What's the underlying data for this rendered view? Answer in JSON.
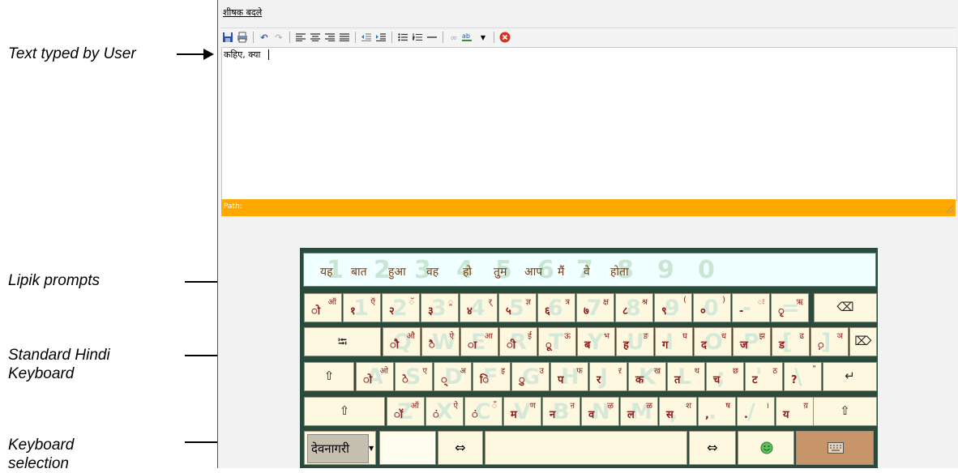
{
  "annotations": {
    "text_typed": "Text typed by User",
    "lipik_prompts": "Lipik prompts",
    "standard_keyboard_line1": "Standard Hindi",
    "standard_keyboard_line2": "Keyboard",
    "keyboard_selection_line1": "Keyboard",
    "keyboard_selection_line2": "selection"
  },
  "editor": {
    "title_link": "शीषक बदले",
    "content": "कहिए, क्या",
    "status_label": "Path:"
  },
  "keyboard": {
    "prompts": [
      "यह",
      "बात",
      "हुआ",
      "वह",
      "हो",
      "तुम",
      "आप",
      "मैं",
      "वे",
      "होता"
    ],
    "prompt_ghost_digits": [
      "1",
      "2",
      "3",
      "4",
      "5",
      "6",
      "7",
      "8",
      "9",
      "0"
    ],
    "rows": [
      [
        {
          "ghost": "",
          "main": "ो",
          "shift": "ऑ"
        },
        {
          "ghost": "1",
          "main": "१",
          "shift": "ऍ"
        },
        {
          "ghost": "2",
          "main": "२",
          "shift": "ॅ"
        },
        {
          "ghost": "3",
          "main": "३",
          "shift": "्र"
        },
        {
          "ghost": "4",
          "main": "४",
          "shift": "र्"
        },
        {
          "ghost": "5",
          "main": "५",
          "shift": "ज्ञ"
        },
        {
          "ghost": "6",
          "main": "६",
          "shift": "त्र"
        },
        {
          "ghost": "7",
          "main": "७",
          "shift": "क्ष"
        },
        {
          "ghost": "8",
          "main": "८",
          "shift": "श्र"
        },
        {
          "ghost": "9",
          "main": "९",
          "shift": "("
        },
        {
          "ghost": "0",
          "main": "०",
          "shift": ")"
        },
        {
          "ghost": "-",
          "main": "-",
          "shift": "ः"
        },
        {
          "ghost": "=",
          "main": "ृ",
          "shift": "ऋ"
        }
      ],
      [
        {
          "ghost": "Q",
          "main": "ौ",
          "shift": "औ"
        },
        {
          "ghost": "W",
          "main": "ै",
          "shift": "ऐ"
        },
        {
          "ghost": "E",
          "main": "ा",
          "shift": "आ"
        },
        {
          "ghost": "R",
          "main": "ी",
          "shift": "ई"
        },
        {
          "ghost": "T",
          "main": "ू",
          "shift": "ऊ"
        },
        {
          "ghost": "Y",
          "main": "ब",
          "shift": "भ"
        },
        {
          "ghost": "U",
          "main": "ह",
          "shift": "ङ"
        },
        {
          "ghost": "I",
          "main": "ग",
          "shift": "घ"
        },
        {
          "ghost": "O",
          "main": "द",
          "shift": "ध"
        },
        {
          "ghost": "P",
          "main": "ज",
          "shift": "झ"
        },
        {
          "ghost": "[",
          "main": "ड",
          "shift": "ढ"
        },
        {
          "ghost": "]",
          "main": "़",
          "shift": "ञ"
        }
      ],
      [
        {
          "ghost": "A",
          "main": "ो",
          "shift": "ओ"
        },
        {
          "ghost": "S",
          "main": "े",
          "shift": "ए"
        },
        {
          "ghost": "D",
          "main": "्",
          "shift": "अ"
        },
        {
          "ghost": "F",
          "main": "ि",
          "shift": "इ"
        },
        {
          "ghost": "G",
          "main": "ु",
          "shift": "उ"
        },
        {
          "ghost": "H",
          "main": "प",
          "shift": "फ"
        },
        {
          "ghost": "J",
          "main": "र",
          "shift": "ऱ"
        },
        {
          "ghost": "K",
          "main": "क",
          "shift": "ख"
        },
        {
          "ghost": "L",
          "main": "त",
          "shift": "थ"
        },
        {
          "ghost": ";",
          "main": "च",
          "shift": "छ"
        },
        {
          "ghost": "'",
          "main": "ट",
          "shift": "ठ"
        },
        {
          "ghost": "\\",
          "main": "?",
          "shift": "\""
        }
      ],
      [
        {
          "ghost": "Z",
          "main": "ॉ",
          "shift": "ऑ"
        },
        {
          "ghost": "X",
          "main": "ं",
          "shift": "ऐ"
        },
        {
          "ghost": "C",
          "main": "ं",
          "shift": "ँ"
        },
        {
          "ghost": "V",
          "main": "म",
          "shift": "ण"
        },
        {
          "ghost": "B",
          "main": "न",
          "shift": "ऩ"
        },
        {
          "ghost": "N",
          "main": "व",
          "shift": "ऴ"
        },
        {
          "ghost": "M",
          "main": "ल",
          "shift": "ळ"
        },
        {
          "ghost": ",",
          "main": "स",
          "shift": "श"
        },
        {
          "ghost": ".",
          "main": ",",
          "shift": "ष"
        },
        {
          "ghost": "/",
          "main": ".",
          "shift": "।"
        },
        {
          "ghost": "",
          "main": "य",
          "shift": "य़"
        }
      ]
    ],
    "layout_select": "देवनागरी",
    "swap_left": "⇔",
    "swap_right": "⇔",
    "backspace_icon": "⌫",
    "delete_icon": "⌦",
    "tab_icon": "⭾",
    "capslock_icon": "⇧",
    "enter_icon": "↵",
    "shift_icon": "⇧"
  },
  "colors": {
    "status_bar": "#ffa800",
    "keyboard_frame": "#2b4a3e",
    "key_face": "#fff8e0",
    "key_text": "#8b1a1a"
  }
}
